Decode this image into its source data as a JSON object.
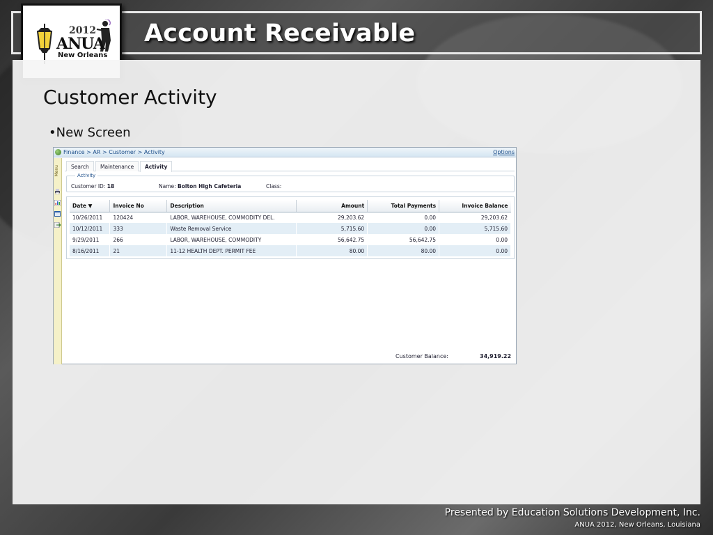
{
  "slide": {
    "title": "Account Receivable",
    "heading": "Customer Activity",
    "bullet": "•New Screen",
    "footer_line1": "Presented by Education Solutions Development, Inc.",
    "footer_line2": "ANUA 2012, New Orleans, Louisiana"
  },
  "logo": {
    "year": "2012",
    "name": "ANUA",
    "city": "New Orleans"
  },
  "app": {
    "breadcrumb": "Finance > AR > Customer > Activity",
    "options_label": "Options",
    "menu_label": "Menu",
    "tabs": [
      {
        "label": "Search",
        "active": false
      },
      {
        "label": "Maintenance",
        "active": false
      },
      {
        "label": "Activity",
        "active": true
      }
    ],
    "activity_group": {
      "legend": "Activity",
      "customer_id_label": "Customer ID:",
      "customer_id_value": "18",
      "name_label": "Name:",
      "name_value": "Bolton High Cafeteria",
      "class_label": "Class:",
      "class_value": ""
    },
    "grid": {
      "columns": [
        "Date ▼",
        "Invoice No",
        "Description",
        "Amount",
        "Total Payments",
        "Invoice Balance"
      ],
      "rows": [
        {
          "date": "10/26/2011",
          "invoice_no": "120424",
          "description": "LABOR, WAREHOUSE, COMMODITY DEL.",
          "amount": "29,203.62",
          "total_payments": "0.00",
          "invoice_balance": "29,203.62"
        },
        {
          "date": "10/12/2011",
          "invoice_no": "333",
          "description": "Waste Removal Service",
          "amount": "5,715.60",
          "total_payments": "0.00",
          "invoice_balance": "5,715.60"
        },
        {
          "date": "9/29/2011",
          "invoice_no": "266",
          "description": "LABOR, WAREHOUSE, COMMODITY",
          "amount": "56,642.75",
          "total_payments": "56,642.75",
          "invoice_balance": "0.00"
        },
        {
          "date": "8/16/2011",
          "invoice_no": "21",
          "description": "11-12 HEALTH DEPT. PERMIT FEE",
          "amount": "80.00",
          "total_payments": "80.00",
          "invoice_balance": "0.00"
        }
      ]
    },
    "balance_label": "Customer Balance:",
    "balance_value": "34,919.22"
  },
  "colors": {
    "link": "#1e4f8a",
    "row_alt": "#e3eef6",
    "menu_bg": "#f5f1c8"
  }
}
